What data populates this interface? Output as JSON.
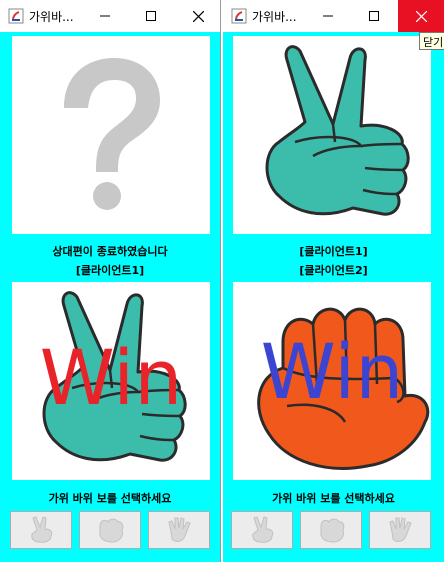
{
  "left_window": {
    "title": "가위바...",
    "status_message": "상대편이 종료하였습니다",
    "opponent_label": "[클라이언트1]",
    "opponent_choice_icon": "question-mark-icon",
    "my_choice_icon": "scissors-hand-icon",
    "result_text": "Win",
    "result_color": "#e8242a",
    "prompt": "가위 바위 보를 선택하세요"
  },
  "right_window": {
    "title": "가위바...",
    "opponent_label": "[클라이언트1]",
    "my_label": "[클라이언트2]",
    "opponent_choice_icon": "scissors-hand-icon",
    "my_choice_icon": "rock-fist-icon",
    "result_text": "Win",
    "result_color": "#3b45d2",
    "prompt": "가위 바위 보를 선택하세요"
  },
  "tooltip": {
    "text": "닫기"
  },
  "choice_buttons": [
    "scissors-icon",
    "rock-icon",
    "paper-icon"
  ],
  "colors": {
    "background": "#00ffff",
    "hand_teal": "#3cbdac",
    "fist_orange": "#f0581c",
    "close_red": "#e81123"
  }
}
